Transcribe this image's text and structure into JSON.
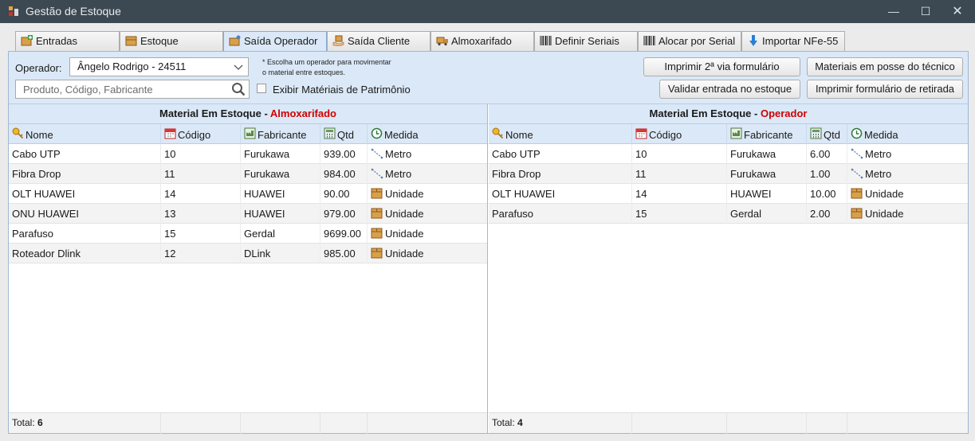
{
  "window": {
    "title": "Gestão de Estoque",
    "minimize": "—",
    "maximize": "☐",
    "close": "✕"
  },
  "tabs": [
    {
      "label": "Entradas",
      "icon": "box-add-icon"
    },
    {
      "label": "Estoque",
      "icon": "box-icon"
    },
    {
      "label": "Saída Operador",
      "icon": "box-person-icon",
      "active": true
    },
    {
      "label": "Saída Cliente",
      "icon": "hand-box-icon"
    },
    {
      "label": "Almoxarifado",
      "icon": "truck-icon"
    },
    {
      "label": "Definir Seriais",
      "icon": "barcode-icon"
    },
    {
      "label": "Alocar por Serial",
      "icon": "barcode-icon"
    },
    {
      "label": "Importar NFe-55",
      "icon": "arrow-down-icon"
    }
  ],
  "toolbar": {
    "operador_label": "Operador:",
    "operador_value": "Ângelo Rodrigo - 24511",
    "hint_line1": "* Escolha um operador para movimentar",
    "hint_line2": "o material entre estoques.",
    "search_placeholder": "Produto, Código, Fabricante",
    "patrimonio_label": "Exibir Matériais de Patrimônio",
    "btn_imprimir_2via": "Imprimir 2ª via formulário",
    "btn_materiais_posse": "Materiais em posse do técnico",
    "btn_validar": "Validar entrada no estoque",
    "btn_imprimir_retirada": "Imprimir formulário de retirada"
  },
  "columns": {
    "nome": "Nome",
    "codigo": "Código",
    "fabricante": "Fabricante",
    "qtd": "Qtd",
    "medida": "Medida"
  },
  "left_grid": {
    "title_prefix": "Material Em Estoque - ",
    "title_highlight": "Almoxarifado",
    "total_label": "Total: ",
    "total": "6",
    "rows": [
      {
        "nome": "Cabo UTP",
        "codigo": "10",
        "fabricante": "Furukawa",
        "qtd": "939.00",
        "medida": "Metro"
      },
      {
        "nome": "Fibra Drop",
        "codigo": "11",
        "fabricante": "Furukawa",
        "qtd": "984.00",
        "medida": "Metro"
      },
      {
        "nome": "OLT HUAWEI",
        "codigo": "14",
        "fabricante": "HUAWEI",
        "qtd": "90.00",
        "medida": "Unidade"
      },
      {
        "nome": "ONU HUAWEI",
        "codigo": "13",
        "fabricante": "HUAWEI",
        "qtd": "979.00",
        "medida": "Unidade"
      },
      {
        "nome": "Parafuso",
        "codigo": "15",
        "fabricante": "Gerdal",
        "qtd": "9699.00",
        "medida": "Unidade"
      },
      {
        "nome": "Roteador Dlink",
        "codigo": "12",
        "fabricante": "DLink",
        "qtd": "985.00",
        "medida": "Unidade"
      }
    ]
  },
  "right_grid": {
    "title_prefix": "Material Em Estoque - ",
    "title_highlight": "Operador",
    "total_label": "Total: ",
    "total": "4",
    "rows": [
      {
        "nome": "Cabo UTP",
        "codigo": "10",
        "fabricante": "Furukawa",
        "qtd": "6.00",
        "medida": "Metro"
      },
      {
        "nome": "Fibra Drop",
        "codigo": "11",
        "fabricante": "Furukawa",
        "qtd": "1.00",
        "medida": "Metro"
      },
      {
        "nome": "OLT HUAWEI",
        "codigo": "14",
        "fabricante": "HUAWEI",
        "qtd": "10.00",
        "medida": "Unidade"
      },
      {
        "nome": "Parafuso",
        "codigo": "15",
        "fabricante": "Gerdal",
        "qtd": "2.00",
        "medida": "Unidade"
      }
    ]
  },
  "colors": {
    "accent_red": "#d00000",
    "header_blue": "#dbe8f7",
    "titlebar": "#3c4852"
  }
}
